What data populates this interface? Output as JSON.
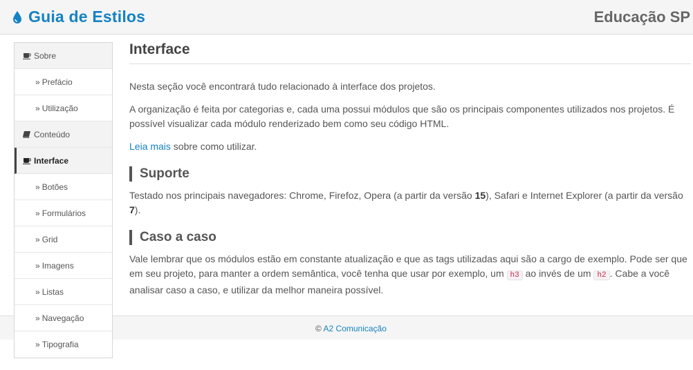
{
  "header": {
    "brand": "Guia de Estilos",
    "org": "Educação SP",
    "brand_icon": "water-drop-icon",
    "brand_color": "#1582c3"
  },
  "sidebar": {
    "items": [
      {
        "label": "Sobre",
        "type": "section",
        "icon": "coffee-cup-icon"
      },
      {
        "label": "Prefácio",
        "type": "sub",
        "prefix": "»"
      },
      {
        "label": "Utilização",
        "type": "sub",
        "prefix": "»"
      },
      {
        "label": "Conteúdo",
        "type": "section",
        "icon": "book-icon"
      },
      {
        "label": "Interface",
        "type": "section-active",
        "icon": "coffee-cup-icon"
      },
      {
        "label": "Botões",
        "type": "sub",
        "prefix": "»"
      },
      {
        "label": "Formulários",
        "type": "sub",
        "prefix": "»"
      },
      {
        "label": "Grid",
        "type": "sub",
        "prefix": "»"
      },
      {
        "label": "Imagens",
        "type": "sub",
        "prefix": "»"
      },
      {
        "label": "Listas",
        "type": "sub",
        "prefix": "»"
      },
      {
        "label": "Navegação",
        "type": "sub",
        "prefix": "»"
      },
      {
        "label": "Tipografia",
        "type": "sub",
        "prefix": "»"
      }
    ]
  },
  "main": {
    "title": "Interface",
    "intro": "Nesta seção você encontrará tudo relacionado à interface dos projetos.",
    "organization": "A organização é feita por categorias e, cada uma possui módulos que são os principais componentes utilizados nos projetos. É possível visualizar cada módulo renderizado bem como seu código HTML.",
    "read_more_link": "Leia mais",
    "read_more_rest": " sobre como utilizar.",
    "suporte": {
      "heading": "Suporte",
      "text_a": "Testado nos principais navegadores: Chrome, Firefoz, Opera (a partir da versão ",
      "num_a": "15",
      "text_b": "), Safari e Internet Explorer (a partir da versão ",
      "num_b": "7",
      "text_c": ")."
    },
    "caso": {
      "heading": "Caso a caso",
      "text_a": "Vale lembrar que os módulos estão em constante atualização e que as tags utilizadas aqui são a cargo de exemplo. Pode ser que em seu projeto, para manter a ordem semântica, você tenha que usar por exemplo, um ",
      "code_a": "h3",
      "text_b": " ao invés de um ",
      "code_b": "h2",
      "text_c": ". Cabe a você analisar caso a caso, e utilizar da melhor maneira possível."
    }
  },
  "footer": {
    "copyright": "©",
    "link": "A2 Comunicação"
  }
}
